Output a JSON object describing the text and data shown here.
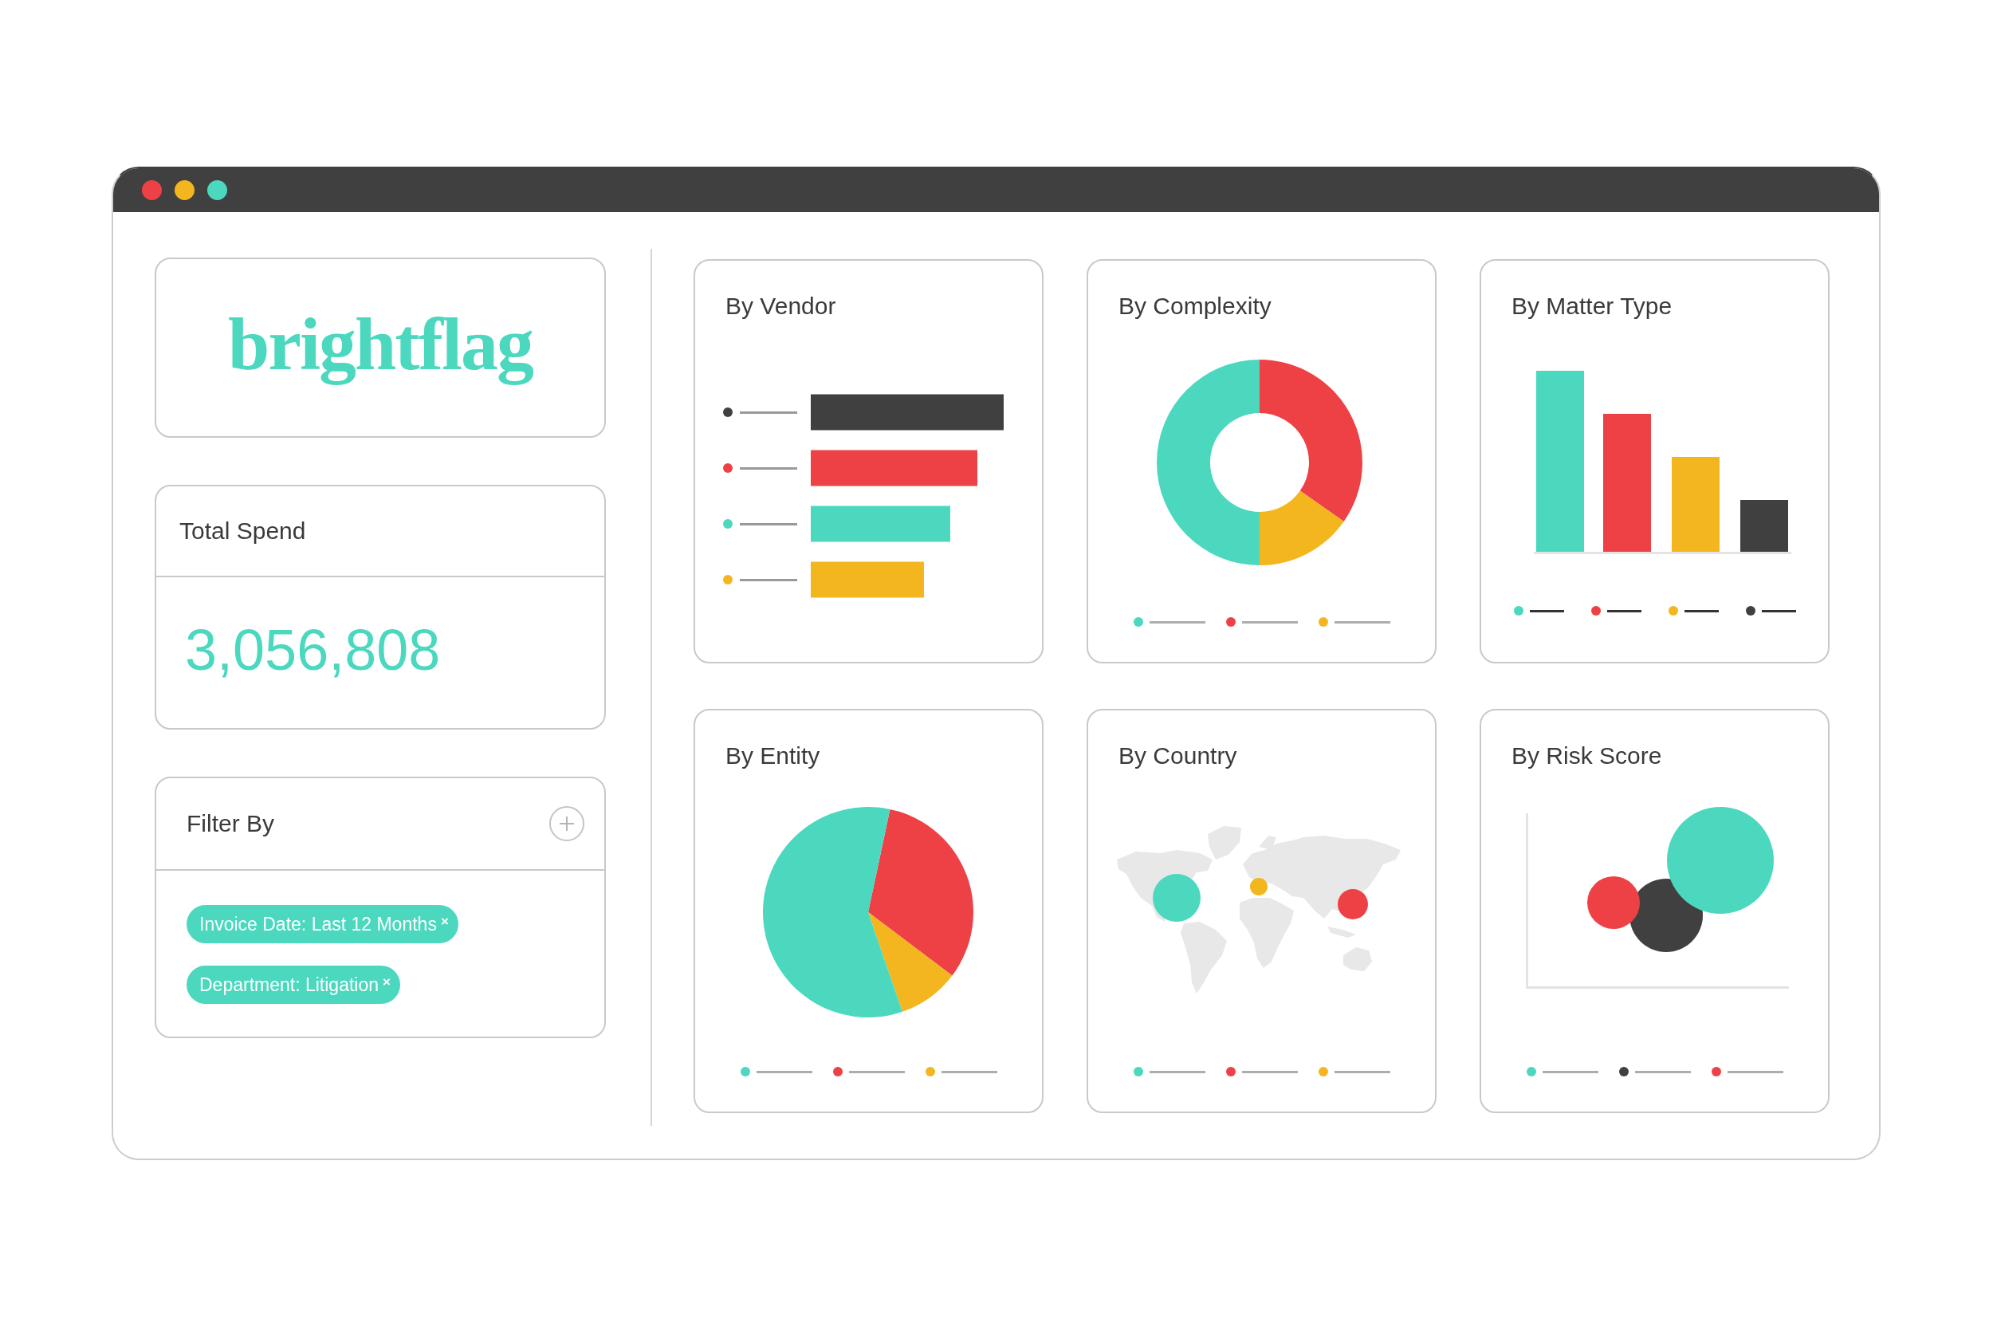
{
  "window": {
    "controls": [
      {
        "color": "#ee4145"
      },
      {
        "color": "#f3b61f"
      },
      {
        "color": "#4bd8bf"
      }
    ]
  },
  "logo": {
    "text": "brightflag"
  },
  "total_spend": {
    "title": "Total Spend",
    "value": "3,056,808"
  },
  "filter": {
    "title": "Filter By",
    "tags": [
      {
        "label": "Invoice Date: Last 12 Months",
        "remove": "×"
      },
      {
        "label": "Department: Litigation",
        "remove": "×"
      }
    ]
  },
  "charts": [
    {
      "kind": "hbar",
      "title": "By Vendor",
      "legend": [
        {
          "color": "#404040"
        },
        {
          "color": "#ee4145"
        },
        {
          "color": "#4bd8bf"
        },
        {
          "color": "#f3b61f"
        }
      ]
    },
    {
      "kind": "donut",
      "title": "By Complexity",
      "legend": [
        {
          "color": "#4bd8bf"
        },
        {
          "color": "#ee4145"
        },
        {
          "color": "#f3b61f"
        }
      ]
    },
    {
      "kind": "bar",
      "title": "By Matter Type",
      "legend": [
        {
          "color": "#4bd8bf"
        },
        {
          "color": "#ee4145"
        },
        {
          "color": "#f3b61f"
        },
        {
          "color": "#404040"
        }
      ]
    },
    {
      "kind": "pie",
      "title": "By Entity",
      "legend": [
        {
          "color": "#4bd8bf"
        },
        {
          "color": "#ee4145"
        },
        {
          "color": "#f3b61f"
        }
      ]
    },
    {
      "kind": "map",
      "title": "By Country",
      "legend": [
        {
          "color": "#4bd8bf"
        },
        {
          "color": "#ee4145"
        },
        {
          "color": "#f3b61f"
        }
      ]
    },
    {
      "kind": "bubble",
      "title": "By Risk Score",
      "legend": [
        {
          "color": "#4bd8bf"
        },
        {
          "color": "#404040"
        },
        {
          "color": "#ee4145"
        }
      ]
    }
  ]
}
